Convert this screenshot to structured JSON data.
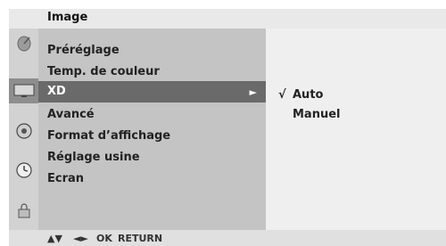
{
  "header": {
    "title": "Image"
  },
  "icons": [
    {
      "name": "antenna-dish-icon"
    },
    {
      "name": "tv-picture-icon"
    },
    {
      "name": "speaker-icon"
    },
    {
      "name": "clock-icon"
    },
    {
      "name": "lock-icon"
    }
  ],
  "menu": {
    "items": [
      {
        "label": "Préréglage"
      },
      {
        "label": "Temp. de couleur"
      },
      {
        "label": "XD"
      },
      {
        "label": "Avancé"
      },
      {
        "label": "Format d’affichage"
      },
      {
        "label": "Réglage usine"
      },
      {
        "label": "Ecran"
      }
    ],
    "selected_index": 2,
    "submenu_arrow": "►"
  },
  "submenu": {
    "options": [
      {
        "label": "Auto",
        "checked": true
      },
      {
        "label": "Manuel",
        "checked": false
      }
    ],
    "check_mark": "√"
  },
  "footer": {
    "updown": "▲▼",
    "leftright": "◄►",
    "ok": "OK",
    "return": "RETURN"
  },
  "colors": {
    "selected_row": "#6a6a6a",
    "left_panel": "#c4c4c4",
    "right_panel": "#efefef",
    "icon_column": "#d2d2d2"
  }
}
